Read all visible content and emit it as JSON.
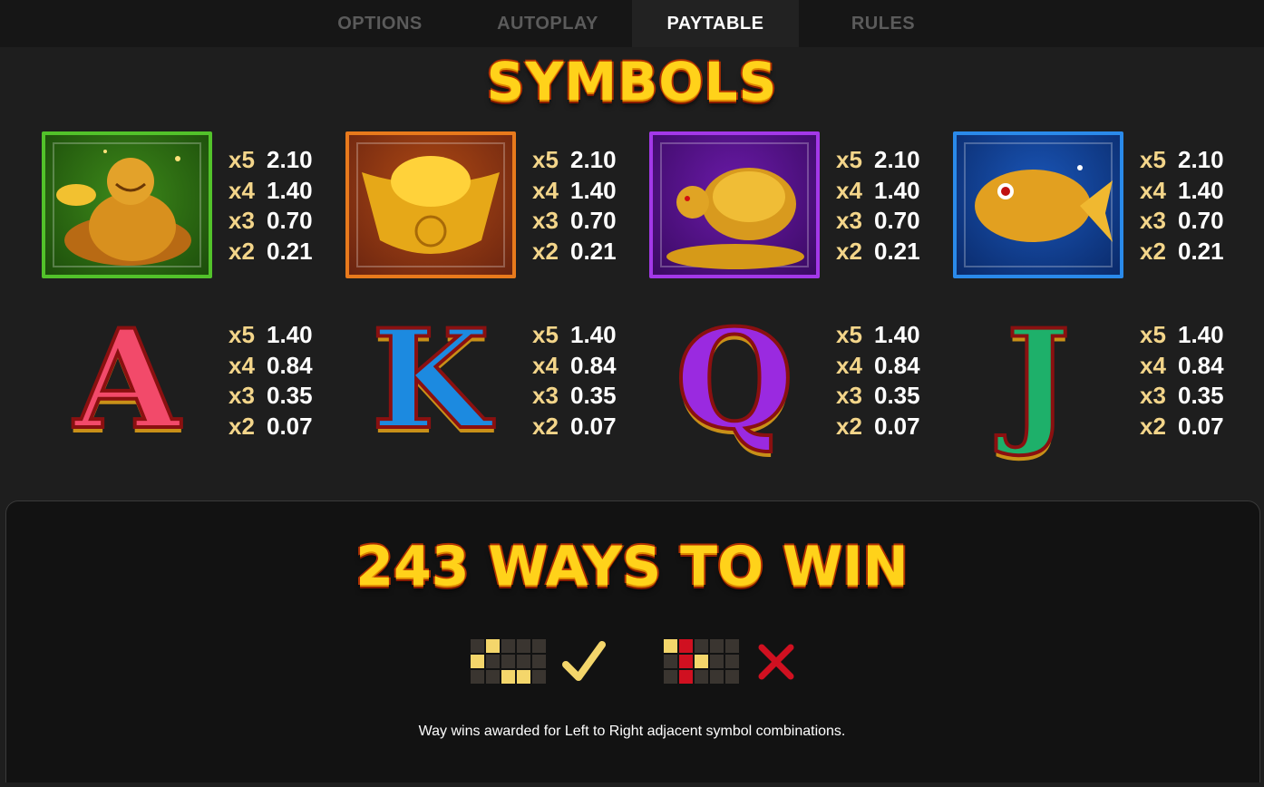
{
  "tabs": [
    "OPTIONS",
    "AUTOPLAY",
    "PAYTABLE",
    "RULES"
  ],
  "active_tab": "PAYTABLE",
  "symbols_title": "SYMBOLS",
  "high_symbols": [
    {
      "name": "buddha",
      "pays": [
        [
          "x5",
          "2.10"
        ],
        [
          "x4",
          "1.40"
        ],
        [
          "x3",
          "0.70"
        ],
        [
          "x2",
          "0.21"
        ]
      ]
    },
    {
      "name": "gold-ingot",
      "pays": [
        [
          "x5",
          "2.10"
        ],
        [
          "x4",
          "1.40"
        ],
        [
          "x3",
          "0.70"
        ],
        [
          "x2",
          "0.21"
        ]
      ]
    },
    {
      "name": "golden-turtle",
      "pays": [
        [
          "x5",
          "2.10"
        ],
        [
          "x4",
          "1.40"
        ],
        [
          "x3",
          "0.70"
        ],
        [
          "x2",
          "0.21"
        ]
      ]
    },
    {
      "name": "golden-koi",
      "pays": [
        [
          "x5",
          "2.10"
        ],
        [
          "x4",
          "1.40"
        ],
        [
          "x3",
          "0.70"
        ],
        [
          "x2",
          "0.21"
        ]
      ]
    }
  ],
  "low_symbols": [
    {
      "letter": "A",
      "pays": [
        [
          "x5",
          "1.40"
        ],
        [
          "x4",
          "0.84"
        ],
        [
          "x3",
          "0.35"
        ],
        [
          "x2",
          "0.07"
        ]
      ]
    },
    {
      "letter": "K",
      "pays": [
        [
          "x5",
          "1.40"
        ],
        [
          "x4",
          "0.84"
        ],
        [
          "x3",
          "0.35"
        ],
        [
          "x2",
          "0.07"
        ]
      ]
    },
    {
      "letter": "Q",
      "pays": [
        [
          "x5",
          "1.40"
        ],
        [
          "x4",
          "0.84"
        ],
        [
          "x3",
          "0.35"
        ],
        [
          "x2",
          "0.07"
        ]
      ]
    },
    {
      "letter": "J",
      "pays": [
        [
          "x5",
          "1.40"
        ],
        [
          "x4",
          "0.84"
        ],
        [
          "x3",
          "0.35"
        ],
        [
          "x2",
          "0.07"
        ]
      ]
    }
  ],
  "ways_title": "243 WAYS TO WIN",
  "caption": "Way wins awarded for Left to Right adjacent symbol combinations.",
  "colors": {
    "green": "#3fb21c",
    "orange": "#e2731a",
    "purple": "#9a2bd8",
    "blue": "#1f7fe0",
    "gold": "#ffd21a"
  }
}
